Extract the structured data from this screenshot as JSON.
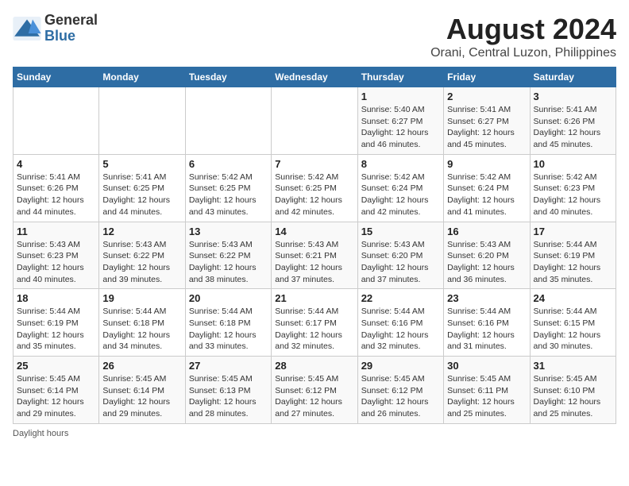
{
  "logo": {
    "text_general": "General",
    "text_blue": "Blue"
  },
  "title": "August 2024",
  "subtitle": "Orani, Central Luzon, Philippines",
  "weekdays": [
    "Sunday",
    "Monday",
    "Tuesday",
    "Wednesday",
    "Thursday",
    "Friday",
    "Saturday"
  ],
  "weeks": [
    [
      {
        "day": "",
        "sunrise": "",
        "sunset": "",
        "daylight": ""
      },
      {
        "day": "",
        "sunrise": "",
        "sunset": "",
        "daylight": ""
      },
      {
        "day": "",
        "sunrise": "",
        "sunset": "",
        "daylight": ""
      },
      {
        "day": "",
        "sunrise": "",
        "sunset": "",
        "daylight": ""
      },
      {
        "day": "1",
        "sunrise": "Sunrise: 5:40 AM",
        "sunset": "Sunset: 6:27 PM",
        "daylight": "Daylight: 12 hours and 46 minutes."
      },
      {
        "day": "2",
        "sunrise": "Sunrise: 5:41 AM",
        "sunset": "Sunset: 6:27 PM",
        "daylight": "Daylight: 12 hours and 45 minutes."
      },
      {
        "day": "3",
        "sunrise": "Sunrise: 5:41 AM",
        "sunset": "Sunset: 6:26 PM",
        "daylight": "Daylight: 12 hours and 45 minutes."
      }
    ],
    [
      {
        "day": "4",
        "sunrise": "Sunrise: 5:41 AM",
        "sunset": "Sunset: 6:26 PM",
        "daylight": "Daylight: 12 hours and 44 minutes."
      },
      {
        "day": "5",
        "sunrise": "Sunrise: 5:41 AM",
        "sunset": "Sunset: 6:25 PM",
        "daylight": "Daylight: 12 hours and 44 minutes."
      },
      {
        "day": "6",
        "sunrise": "Sunrise: 5:42 AM",
        "sunset": "Sunset: 6:25 PM",
        "daylight": "Daylight: 12 hours and 43 minutes."
      },
      {
        "day": "7",
        "sunrise": "Sunrise: 5:42 AM",
        "sunset": "Sunset: 6:25 PM",
        "daylight": "Daylight: 12 hours and 42 minutes."
      },
      {
        "day": "8",
        "sunrise": "Sunrise: 5:42 AM",
        "sunset": "Sunset: 6:24 PM",
        "daylight": "Daylight: 12 hours and 42 minutes."
      },
      {
        "day": "9",
        "sunrise": "Sunrise: 5:42 AM",
        "sunset": "Sunset: 6:24 PM",
        "daylight": "Daylight: 12 hours and 41 minutes."
      },
      {
        "day": "10",
        "sunrise": "Sunrise: 5:42 AM",
        "sunset": "Sunset: 6:23 PM",
        "daylight": "Daylight: 12 hours and 40 minutes."
      }
    ],
    [
      {
        "day": "11",
        "sunrise": "Sunrise: 5:43 AM",
        "sunset": "Sunset: 6:23 PM",
        "daylight": "Daylight: 12 hours and 40 minutes."
      },
      {
        "day": "12",
        "sunrise": "Sunrise: 5:43 AM",
        "sunset": "Sunset: 6:22 PM",
        "daylight": "Daylight: 12 hours and 39 minutes."
      },
      {
        "day": "13",
        "sunrise": "Sunrise: 5:43 AM",
        "sunset": "Sunset: 6:22 PM",
        "daylight": "Daylight: 12 hours and 38 minutes."
      },
      {
        "day": "14",
        "sunrise": "Sunrise: 5:43 AM",
        "sunset": "Sunset: 6:21 PM",
        "daylight": "Daylight: 12 hours and 37 minutes."
      },
      {
        "day": "15",
        "sunrise": "Sunrise: 5:43 AM",
        "sunset": "Sunset: 6:20 PM",
        "daylight": "Daylight: 12 hours and 37 minutes."
      },
      {
        "day": "16",
        "sunrise": "Sunrise: 5:43 AM",
        "sunset": "Sunset: 6:20 PM",
        "daylight": "Daylight: 12 hours and 36 minutes."
      },
      {
        "day": "17",
        "sunrise": "Sunrise: 5:44 AM",
        "sunset": "Sunset: 6:19 PM",
        "daylight": "Daylight: 12 hours and 35 minutes."
      }
    ],
    [
      {
        "day": "18",
        "sunrise": "Sunrise: 5:44 AM",
        "sunset": "Sunset: 6:19 PM",
        "daylight": "Daylight: 12 hours and 35 minutes."
      },
      {
        "day": "19",
        "sunrise": "Sunrise: 5:44 AM",
        "sunset": "Sunset: 6:18 PM",
        "daylight": "Daylight: 12 hours and 34 minutes."
      },
      {
        "day": "20",
        "sunrise": "Sunrise: 5:44 AM",
        "sunset": "Sunset: 6:18 PM",
        "daylight": "Daylight: 12 hours and 33 minutes."
      },
      {
        "day": "21",
        "sunrise": "Sunrise: 5:44 AM",
        "sunset": "Sunset: 6:17 PM",
        "daylight": "Daylight: 12 hours and 32 minutes."
      },
      {
        "day": "22",
        "sunrise": "Sunrise: 5:44 AM",
        "sunset": "Sunset: 6:16 PM",
        "daylight": "Daylight: 12 hours and 32 minutes."
      },
      {
        "day": "23",
        "sunrise": "Sunrise: 5:44 AM",
        "sunset": "Sunset: 6:16 PM",
        "daylight": "Daylight: 12 hours and 31 minutes."
      },
      {
        "day": "24",
        "sunrise": "Sunrise: 5:44 AM",
        "sunset": "Sunset: 6:15 PM",
        "daylight": "Daylight: 12 hours and 30 minutes."
      }
    ],
    [
      {
        "day": "25",
        "sunrise": "Sunrise: 5:45 AM",
        "sunset": "Sunset: 6:14 PM",
        "daylight": "Daylight: 12 hours and 29 minutes."
      },
      {
        "day": "26",
        "sunrise": "Sunrise: 5:45 AM",
        "sunset": "Sunset: 6:14 PM",
        "daylight": "Daylight: 12 hours and 29 minutes."
      },
      {
        "day": "27",
        "sunrise": "Sunrise: 5:45 AM",
        "sunset": "Sunset: 6:13 PM",
        "daylight": "Daylight: 12 hours and 28 minutes."
      },
      {
        "day": "28",
        "sunrise": "Sunrise: 5:45 AM",
        "sunset": "Sunset: 6:12 PM",
        "daylight": "Daylight: 12 hours and 27 minutes."
      },
      {
        "day": "29",
        "sunrise": "Sunrise: 5:45 AM",
        "sunset": "Sunset: 6:12 PM",
        "daylight": "Daylight: 12 hours and 26 minutes."
      },
      {
        "day": "30",
        "sunrise": "Sunrise: 5:45 AM",
        "sunset": "Sunset: 6:11 PM",
        "daylight": "Daylight: 12 hours and 25 minutes."
      },
      {
        "day": "31",
        "sunrise": "Sunrise: 5:45 AM",
        "sunset": "Sunset: 6:10 PM",
        "daylight": "Daylight: 12 hours and 25 minutes."
      }
    ]
  ],
  "footer": "Daylight hours"
}
